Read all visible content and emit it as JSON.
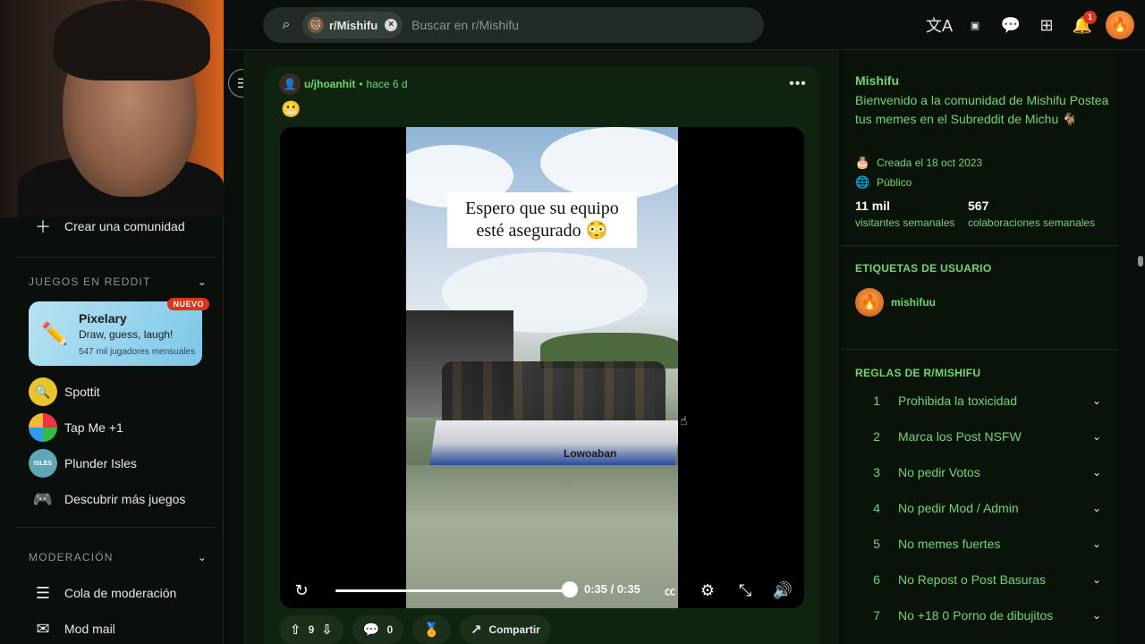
{
  "search": {
    "chip_label": "r/Mishifu",
    "placeholder": "Buscar en r/Mishifu"
  },
  "header": {
    "notifications_count": "1",
    "icons": [
      "translate-icon",
      "ads-icon",
      "chat-icon",
      "create-icon",
      "bell-icon",
      "user-avatar"
    ]
  },
  "sidebar": {
    "create_community": "Crear una comunidad",
    "games_heading": "JUEGOS EN REDDIT",
    "featured_game": {
      "title": "Pixelary",
      "subtitle": "Draw, guess, laugh!",
      "meta": "547 mil jugadores mensuales",
      "badge": "NUEVO"
    },
    "games": [
      "Spottit",
      "Tap Me +1",
      "Plunder Isles"
    ],
    "discover": "Descubrir más juegos",
    "mod_heading": "MODERACIÓN",
    "mod_items": [
      "Cola de moderación",
      "Mod mail"
    ]
  },
  "post": {
    "author": "u/jhoanhit",
    "time": "hace 6 d",
    "body_emoji": "😬",
    "video_caption_line1": "Espero que su equipo",
    "video_caption_line2": "esté asegurado 😳",
    "boat_label": "Lowoaban",
    "timecode": "0:35 / 0:35",
    "progress": 1.0,
    "votes": "9",
    "comments": "0",
    "share": "Compartir"
  },
  "community": {
    "name": "Mishifu",
    "description": "Bienvenido a la comunidad de Mishifu Postea tus memes en el Subreddit de Michu 🐐",
    "created": "Creada el 18 oct 2023",
    "visibility": "Público",
    "visitors_num": "11 mil",
    "visitors_label": "visitantes semanales",
    "contrib_num": "567",
    "contrib_label": "colaboraciones semanales",
    "flair_heading": "ETIQUETAS DE USUARIO",
    "flair_name": "mishifuu",
    "rules_heading": "REGLAS DE R/MISHIFU",
    "rules": [
      {
        "n": "1",
        "t": "Prohibida la toxicidad"
      },
      {
        "n": "2",
        "t": "Marca los Post NSFW"
      },
      {
        "n": "3",
        "t": "No pedir Votos"
      },
      {
        "n": "4",
        "t": "No pedir Mod / Admin"
      },
      {
        "n": "5",
        "t": "No memes fuertes"
      },
      {
        "n": "6",
        "t": "No Repost o Post Basuras"
      },
      {
        "n": "7",
        "t": "No +18 0 Porno de dibujitos"
      }
    ]
  }
}
